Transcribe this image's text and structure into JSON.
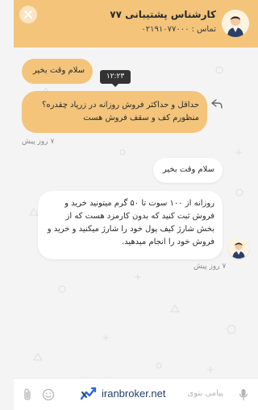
{
  "header": {
    "agent_name": "کارشناس پشتیبانی ۷۷",
    "agent_phone": "تماس : ۰۲۱۹۱۰۷۷۰۰۰"
  },
  "messages": [
    {
      "text": "سلام وقت بخیر",
      "side": "mine"
    },
    {
      "tooltip_time": "۱۲:۲۳",
      "line1": "حداقل و حداکثر فروش روزانه در زرپاد چقدره؟",
      "line2": "منظورم کف و سقف فروش هست",
      "side": "mine",
      "meta": "۷ روز پیش"
    },
    {
      "text": "سلام وقت بخیر",
      "side": "theirs"
    },
    {
      "line1": "روزانه از ۱۰۰ سوت تا ۵۰ گرم میتونید خرید و",
      "line2": "فروش ثبت کنید که بدون کارمزد هست که از",
      "line3": "بخش شارژ کیف پول خود را شارژ میکنید و خرید و",
      "line4": "فروش خود را انجام میدهید.",
      "side": "theirs",
      "meta": "۷ روز پیش"
    }
  ],
  "footer": {
    "input_placeholder": "پیامی بنوی",
    "brand": "iranbroker.net"
  },
  "colors": {
    "accent": "#f3c47a",
    "brand": "#24406e"
  }
}
